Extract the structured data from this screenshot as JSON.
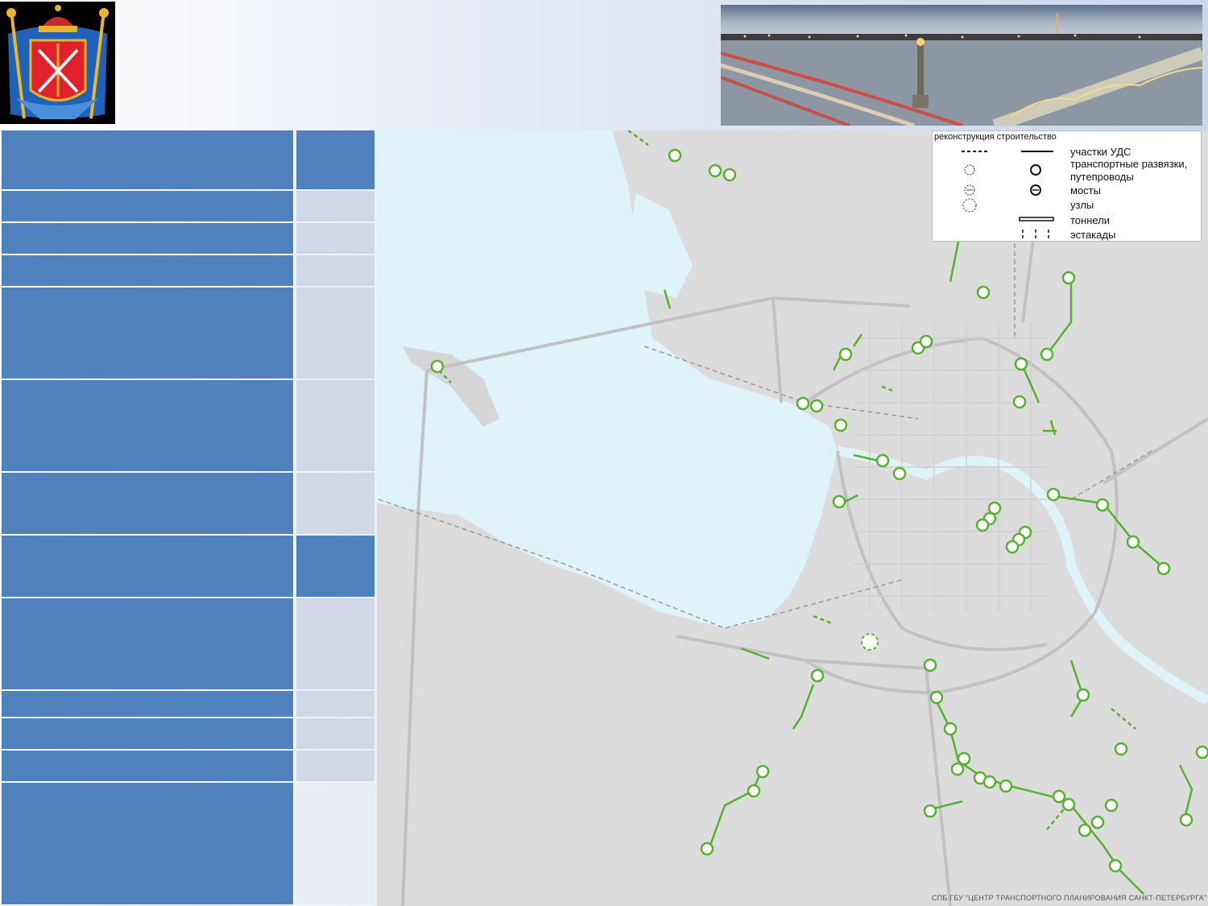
{
  "legend": {
    "header": "реконструкция строительство",
    "items": [
      "участки УДС",
      "транспортные развязки,",
      "путепроводы",
      "мосты",
      "узлы",
      "тоннели",
      "эстакады"
    ]
  },
  "credit": "СПБ ГБУ \"ЦЕНТР ТРАНСПОРТНОГО ПЛАНИРОВАНИЯ САНКТ-ПЕТЕРБУРГА\"",
  "colors": {
    "table_blue": "#4f81bd",
    "table_light": "#d0d8e8",
    "water": "#dff3fb",
    "land": "#dcdcdc",
    "project_green": "#57b030"
  },
  "icons": [
    "coat-of-arms-icon",
    "bridge-photo",
    "interchange-icon",
    "bridge-icon",
    "node-icon"
  ]
}
